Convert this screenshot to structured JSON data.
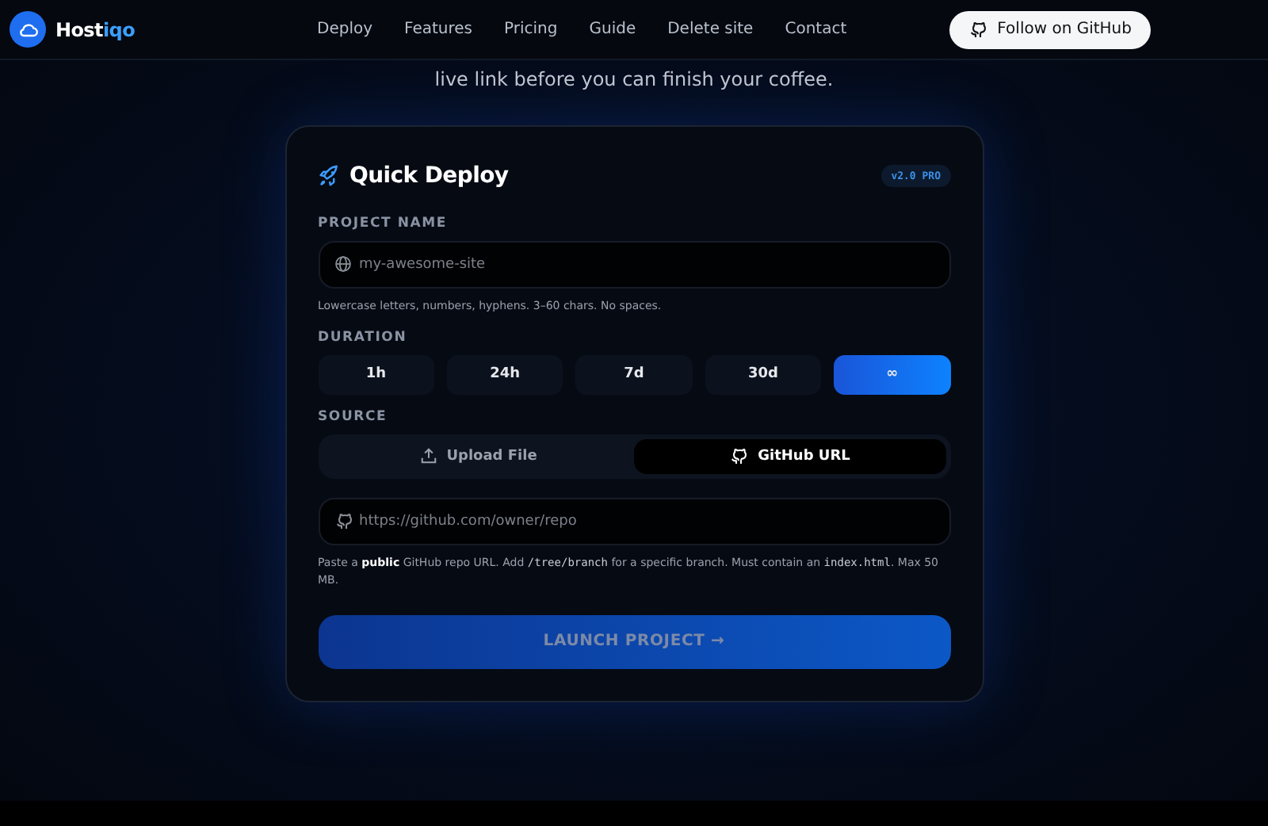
{
  "brand": {
    "name": "Host",
    "accent": "iqo"
  },
  "nav": [
    {
      "label": "Deploy"
    },
    {
      "label": "Features"
    },
    {
      "label": "Pricing"
    },
    {
      "label": "Guide"
    },
    {
      "label": "Delete site"
    },
    {
      "label": "Contact"
    }
  ],
  "github_button": {
    "label": "Follow on GitHub"
  },
  "subtitle": "live link before you can finish your coffee.",
  "card": {
    "title": "Quick Deploy",
    "badge": "v2.0 PRO",
    "project_name": {
      "label": "PROJECT NAME",
      "placeholder": "my-awesome-site",
      "hint": "Lowercase letters, numbers, hyphens. 3–60 chars. No spaces."
    },
    "duration": {
      "label": "DURATION",
      "options": [
        {
          "label": "1h",
          "selected": false
        },
        {
          "label": "24h",
          "selected": false
        },
        {
          "label": "7d",
          "selected": false
        },
        {
          "label": "30d",
          "selected": false
        },
        {
          "label": "∞",
          "selected": true
        }
      ]
    },
    "source": {
      "label": "SOURCE",
      "options": [
        {
          "label": "Upload File",
          "kind": "upload",
          "selected": false
        },
        {
          "label": "GitHub URL",
          "kind": "github",
          "selected": true
        }
      ],
      "url_placeholder": "https://github.com/owner/repo",
      "hint": [
        {
          "kind": "text",
          "text": "Paste a "
        },
        {
          "kind": "bold",
          "text": "public"
        },
        {
          "kind": "text",
          "text": " GitHub repo URL. Add "
        },
        {
          "kind": "code",
          "text": "/tree/branch"
        },
        {
          "kind": "text",
          "text": " for a specific branch. Must contain an "
        },
        {
          "kind": "code",
          "text": "index.html"
        },
        {
          "kind": "text",
          "text": ". Max 50 MB."
        }
      ]
    },
    "launch": {
      "label": "LAUNCH PROJECT →",
      "disabled": true
    }
  }
}
